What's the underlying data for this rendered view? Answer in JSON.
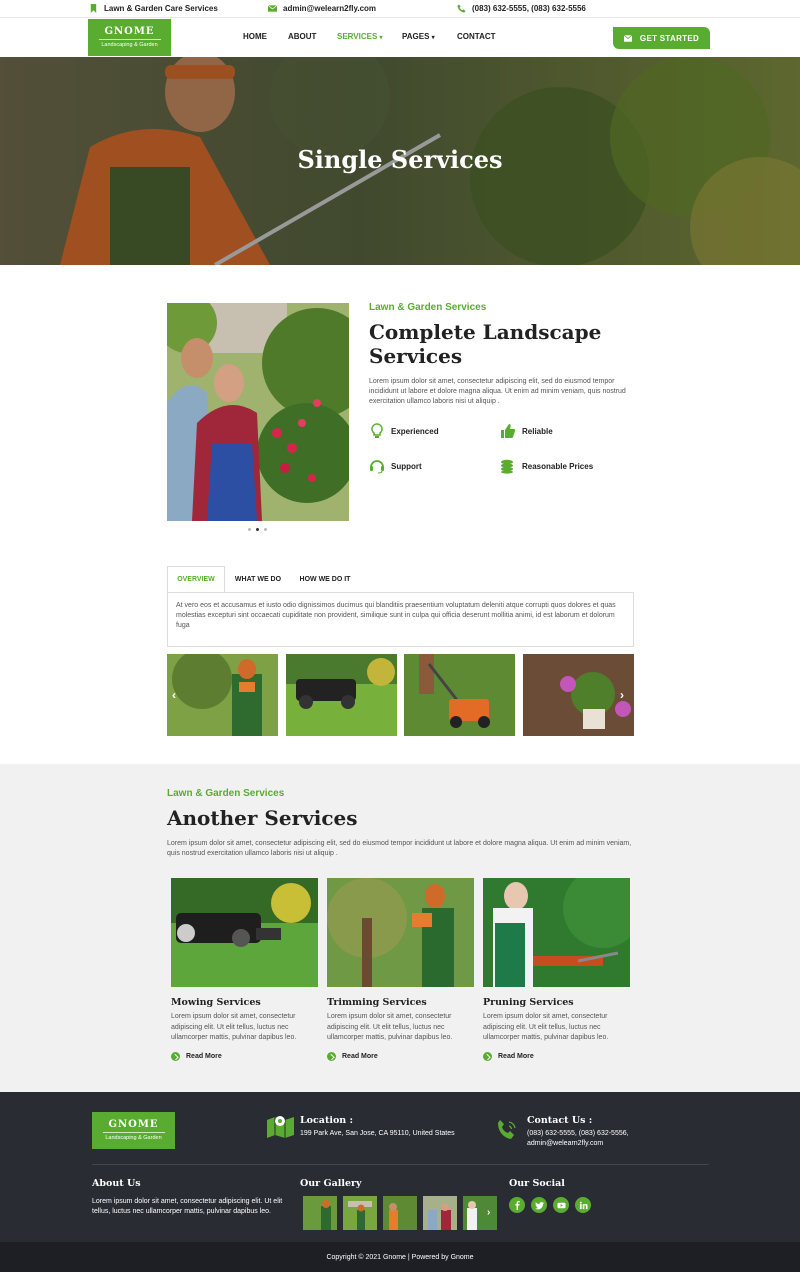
{
  "topbar": {
    "tagline": "Lawn & Garden Care Services",
    "email": "admin@welearn2fly.com",
    "phone": "(083) 632-5555, (083) 632-5556"
  },
  "brand": {
    "name": "GNOME",
    "tagline": "Landscaping & Garden"
  },
  "nav": {
    "items": [
      "HOME",
      "ABOUT",
      "SERVICES",
      "PAGES",
      "CONTACT"
    ],
    "active": "SERVICES",
    "cta": "GET STARTED"
  },
  "hero": {
    "title": "Single Services"
  },
  "about": {
    "subtitle": "Lawn & Garden Services",
    "title_line1": "Complete Landscape",
    "title_line2": "Services",
    "text": "Lorem ipsum dolor sit amet, consectetur adipiscing elit, sed do eiusmod tempor incididunt ut labore et dolore magna aliqua. Ut enim ad minim veniam, quis nostrud exercitation ullamco laboris nisi ut aliquip .",
    "features": [
      "Experienced",
      "Reliable",
      "Support",
      "Reasonable Prices"
    ]
  },
  "tabs": {
    "labels": [
      "OVERVIEW",
      "WHAT WE DO",
      "HOW WE DO IT"
    ],
    "active": "OVERVIEW",
    "content": "At vero eos et accusamus et iusto odio dignissimos ducimus qui blanditiis praesentium voluptatum deleniti atque corrupti quos dolores et quas molestias excepturi sint occaecati cupiditate non provident, similique sunt in culpa qui officia deserunt mollitia animi, id est laborum et dolorum fuga"
  },
  "another": {
    "subtitle": "Lawn & Garden Services",
    "title": "Another Services",
    "text": "Lorem ipsum dolor sit amet, consectetur adipiscing elit, sed do eiusmod tempor incididunt ut labore et dolore magna aliqua. Ut enim ad minim veniam, quis nostrud exercitation ullamco laboris nisi ut aliquip .",
    "cards": [
      {
        "title": "Mowing Services",
        "text": "Lorem ipsum dolor sit amet, consectetur adipiscing elit. Ut elit tellus, luctus nec ullamcorper mattis, pulvinar dapibus leo.",
        "link": "Read More"
      },
      {
        "title": "Trimming Services",
        "text": "Lorem ipsum dolor sit amet, consectetur adipiscing elit. Ut elit tellus, luctus nec ullamcorper mattis, pulvinar dapibus leo.",
        "link": "Read More"
      },
      {
        "title": "Pruning Services",
        "text": "Lorem ipsum dolor sit amet, consectetur adipiscing elit. Ut elit tellus, luctus nec ullamcorper mattis, pulvinar dapibus leo.",
        "link": "Read More"
      }
    ]
  },
  "footer": {
    "location_title": "Location :",
    "location_text": "199 Park Ave, San Jose, CA 95110, United States",
    "contact_title": "Contact Us :",
    "contact_phone": "(083) 632-5555, (083) 632-5556,",
    "contact_email": "admin@welearn2fly.com",
    "about_title": "About Us",
    "about_text": "Lorem ipsum dolor sit amet, consectetur adipiscing elit. Ut elit tellus, luctus nec ullamcorper mattis, pulvinar dapibus leo.",
    "gallery_title": "Our Gallery",
    "social_title": "Our Social",
    "social_icons": [
      "facebook-icon",
      "twitter-icon",
      "youtube-icon",
      "linkedin-icon"
    ]
  },
  "copyright": "Copyright © 2021 Gnome | Powered by Gnome",
  "colors": {
    "accent": "#5aac31",
    "footer": "#2a2c34",
    "text": "#222222"
  }
}
